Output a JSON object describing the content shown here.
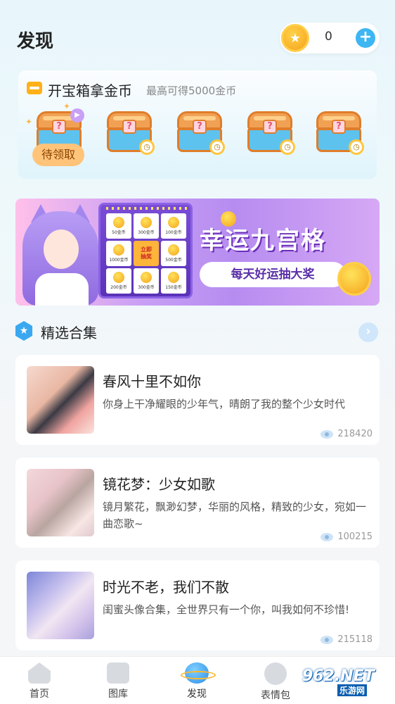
{
  "header": {
    "title": "发现",
    "coins": "0",
    "add_label": "+"
  },
  "treasure": {
    "title": "开宝箱拿金币",
    "subtitle": "最高可得5000金币",
    "claim_label": "待领取",
    "chest_mark": "?"
  },
  "banner": {
    "title": "幸运九宫格",
    "pill": "每天好运抽大奖",
    "center_cell": "立即\n抽奖",
    "cells": [
      "50金币",
      "300金币",
      "100金币",
      "1000金币",
      "500金币",
      "200金币",
      "300金币",
      "150金币"
    ]
  },
  "section": {
    "title": "精选合集"
  },
  "collections": [
    {
      "title": "春风十里不如你",
      "desc": "你身上干净耀眼的少年气，晴朗了我的整个少女时代",
      "views": "218420"
    },
    {
      "title": "镜花梦：少女如歌",
      "desc": "镜月繁花，飘渺幻梦，华丽的风格，精致的少女，宛如一曲恋歌~",
      "views": "100215"
    },
    {
      "title": "时光不老，我们不散",
      "desc": "闺蜜头像合集，全世界只有一个你，叫我如何不珍惜!",
      "views": "215118"
    }
  ],
  "tabs": [
    {
      "label": "首页",
      "icon": "home-icon"
    },
    {
      "label": "图库",
      "icon": "gallery-icon"
    },
    {
      "label": "发现",
      "icon": "planet-icon"
    },
    {
      "label": "表情包",
      "icon": "emoji-icon"
    }
  ],
  "watermark": {
    "text": "962.NET",
    "sub": "乐游网"
  },
  "colors": {
    "accent": "#3eb6f3",
    "coin": "#f5a21a",
    "banner": "#b68cf0"
  }
}
